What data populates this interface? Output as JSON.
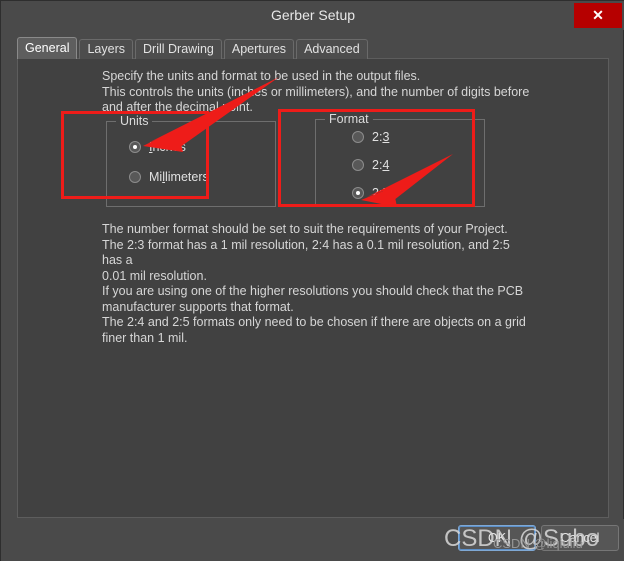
{
  "window": {
    "title": "Gerber Setup",
    "close_icon": "close-icon",
    "close_label": "✕"
  },
  "tabs": [
    {
      "label": "General",
      "active": true
    },
    {
      "label": "Layers",
      "active": false
    },
    {
      "label": "Drill Drawing",
      "active": false
    },
    {
      "label": "Apertures",
      "active": false
    },
    {
      "label": "Advanced",
      "active": false
    }
  ],
  "main": {
    "description_top": "Specify the units and format to be used in the output files.\nThis controls the units (inches or millimeters), and the number of digits before\nand after the decimal point.",
    "description_bottom": "The number format should be set to suit the requirements of your Project.\nThe 2:3 format has a 1 mil resolution, 2:4 has a 0.1 mil resolution, and 2:5 has a\n0.01 mil resolution.\nIf you are using one of the higher resolutions you should check that the PCB\nmanufacturer supports that format.\nThe 2:4 and 2:5 formats only need to be chosen if there are objects on a grid\nfiner than 1 mil.",
    "units_group": {
      "title": "Units",
      "options": [
        {
          "label": "Inches",
          "mnemonic": "I",
          "rest": "nches",
          "selected": true
        },
        {
          "label": "Millimeters",
          "mnemonic": "l",
          "prefix": "Mil",
          "rest": "imeters",
          "selected": false
        }
      ]
    },
    "format_group": {
      "title": "Format",
      "options": [
        {
          "label": "2:3",
          "prefix": "2:",
          "mnemonic": "3",
          "selected": false
        },
        {
          "label": "2:4",
          "prefix": "2:",
          "mnemonic": "4",
          "selected": false
        },
        {
          "label": "2:5",
          "prefix": "2:",
          "mnemonic": "5",
          "selected": true
        }
      ]
    }
  },
  "buttons": {
    "ok_label": "OK",
    "cancel_label": "Cancel"
  },
  "watermark": {
    "main_text": "CSDN @Subo",
    "sub_text": "CSDN @liqiuliu"
  },
  "annotations": {
    "color": "#ee1c19",
    "arrow_units_target": "Inches radio button",
    "arrow_format_target": "2:5 radio button",
    "rect_units_target": "Units group box",
    "rect_format_target": "Format group box"
  }
}
